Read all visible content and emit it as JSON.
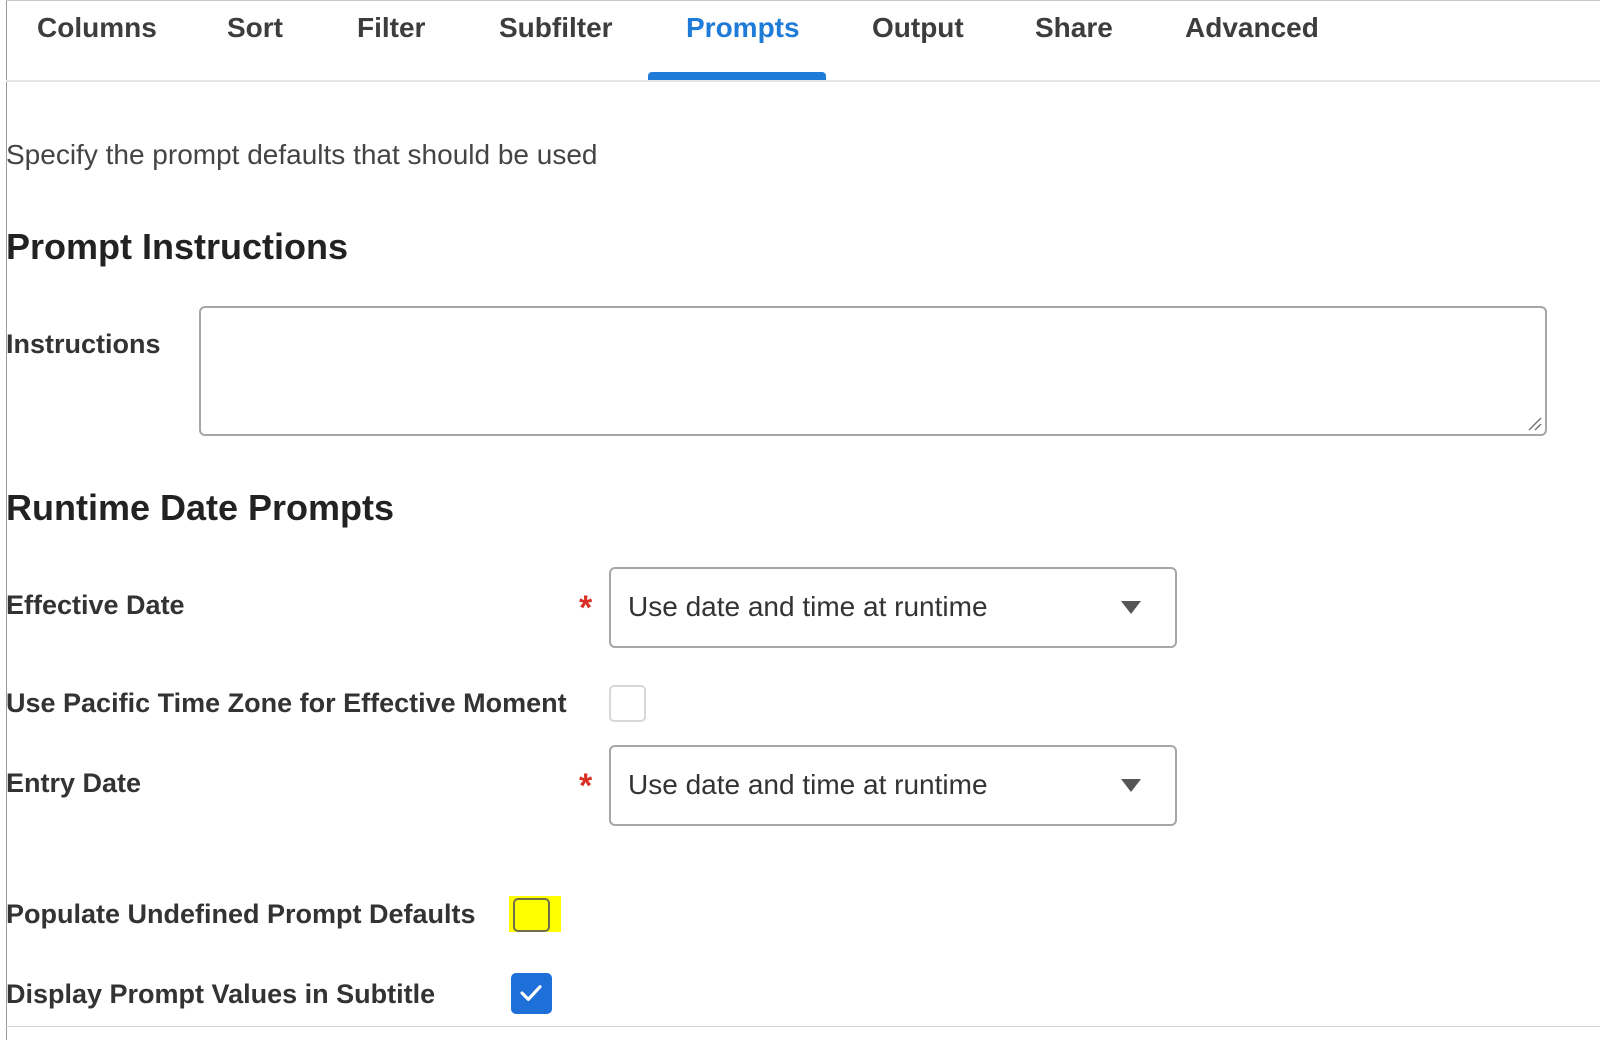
{
  "tabs": [
    {
      "label": "Columns",
      "active": false
    },
    {
      "label": "Sort",
      "active": false
    },
    {
      "label": "Filter",
      "active": false
    },
    {
      "label": "Subfilter",
      "active": false
    },
    {
      "label": "Prompts",
      "active": true
    },
    {
      "label": "Output",
      "active": false
    },
    {
      "label": "Share",
      "active": false
    },
    {
      "label": "Advanced",
      "active": false
    }
  ],
  "description": "Specify the prompt defaults that should be used",
  "prompt_instructions": {
    "title": "Prompt Instructions",
    "instructions_label": "Instructions",
    "instructions_value": ""
  },
  "runtime_date_prompts": {
    "title": "Runtime Date Prompts",
    "effective_date": {
      "label": "Effective Date",
      "required_mark": "*",
      "value": "Use date and time at runtime"
    },
    "pacific_time_zone": {
      "label": "Use Pacific Time Zone for Effective Moment",
      "checked": false
    },
    "entry_date": {
      "label": "Entry Date",
      "required_mark": "*",
      "value": "Use date and time at runtime"
    }
  },
  "options": {
    "populate_undefined_defaults": {
      "label": "Populate Undefined Prompt Defaults",
      "checked": false,
      "highlight_color": "#ffff00"
    },
    "display_prompt_values": {
      "label": "Display Prompt Values in Subtitle",
      "checked": true
    }
  },
  "colors": {
    "accent": "#1f7bd8",
    "required": "#d93025",
    "checkbox_checked": "#1f6fd9"
  },
  "icons": {
    "dropdown": "chevron-down-icon",
    "check": "checkmark-icon",
    "resize": "resize-grip-icon"
  }
}
